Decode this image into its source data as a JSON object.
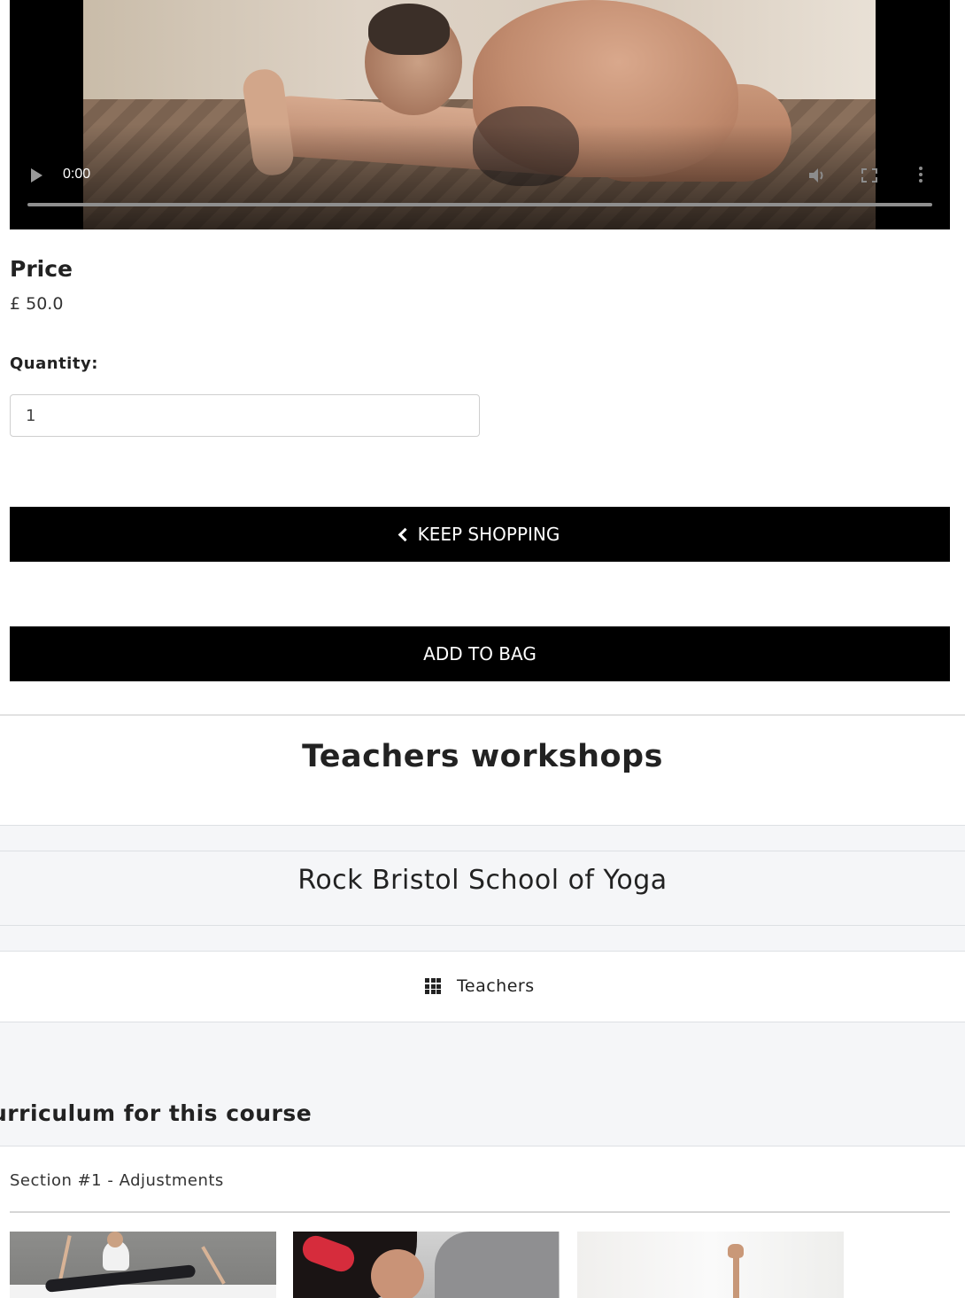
{
  "video": {
    "time": "0:00",
    "progress": 0,
    "play_icon": "play-icon",
    "volume_icon": "volume-icon",
    "fullscreen_icon": "fullscreen-icon",
    "menu_icon": "more-vert-icon"
  },
  "product": {
    "price_label": "Price",
    "price_value": "£ 50.0",
    "quantity_label": "Quantity:",
    "quantity_value": "1"
  },
  "buttons": {
    "keep_shopping": "KEEP SHOPPING",
    "keep_shopping_icon": "chevron-left-icon",
    "add_to_bag": "ADD TO BAG"
  },
  "course": {
    "title": "Teachers workshops",
    "school": "Rock Bristol School of Yoga",
    "teachers_link": "Teachers",
    "teachers_icon": "grid-icon"
  },
  "curriculum": {
    "title": "urriculum for this course",
    "section": "Section #1 - Adjustments"
  },
  "colors": {
    "button_bg": "#000000",
    "button_text": "#ffffff",
    "band_bg": "#f5f6f8",
    "text": "#222222"
  }
}
